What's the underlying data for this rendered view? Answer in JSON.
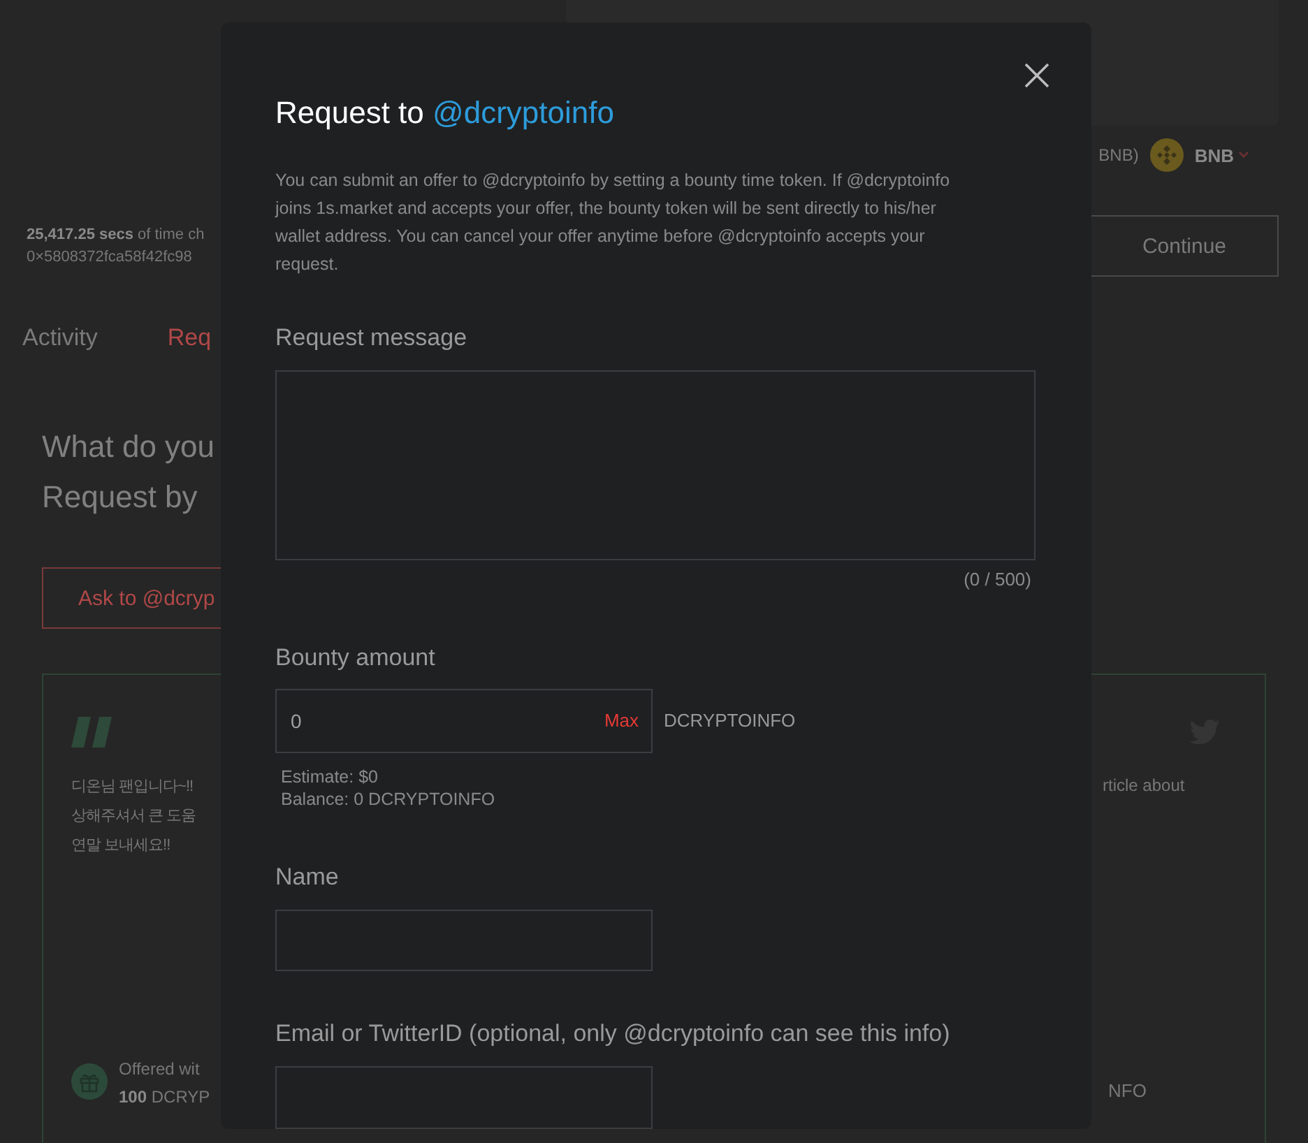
{
  "background_page": {
    "currency": {
      "partial_label": "BNB)",
      "selected": "BNB"
    },
    "stats": {
      "amount": "25,417.25 secs",
      "rest": "of time ch",
      "address": "0×5808372fca58f42fc98"
    },
    "continue_button": "Continue",
    "tabs": [
      {
        "label": "Activity",
        "selected": false
      },
      {
        "label": "Req",
        "selected": true
      }
    ],
    "heading": [
      "What do you",
      "Request by"
    ],
    "ask_button": "Ask to @dcryp",
    "cards": [
      {
        "kind": "quote",
        "lines": [
          "디온님 팬입니다~!!",
          "상해주셔서 큰 도움",
          "연말 보내세요!!"
        ],
        "offer_label": "Offered wit",
        "offer_amount": "100",
        "offer_token": "DCRYP"
      },
      {
        "kind": "tweet",
        "lines": [
          "rticle about"
        ],
        "offer_token": "NFO"
      }
    ]
  },
  "modal": {
    "title": {
      "prefix": "Request to",
      "handle": "@dcryptoinfo"
    },
    "description": "You can submit an offer to @dcryptoinfo by setting a bounty time token. If @dcryptoinfo joins 1s.market and accepts your offer, the bounty token will be sent directly to his/her wallet address. You can cancel your offer anytime before @dcryptoinfo accepts your request.",
    "message": {
      "label": "Request message",
      "counter": "(0 / 500)"
    },
    "bounty": {
      "label": "Bounty amount",
      "value": "0",
      "max": "Max",
      "token": "DCRYPTOINFO",
      "estimate": "Estimate: $0",
      "balance": "Balance: 0 DCRYPTOINFO"
    },
    "name": {
      "label": "Name"
    },
    "email": {
      "label": "Email or TwitterID (optional, only @dcryptoinfo can see this info)"
    }
  }
}
